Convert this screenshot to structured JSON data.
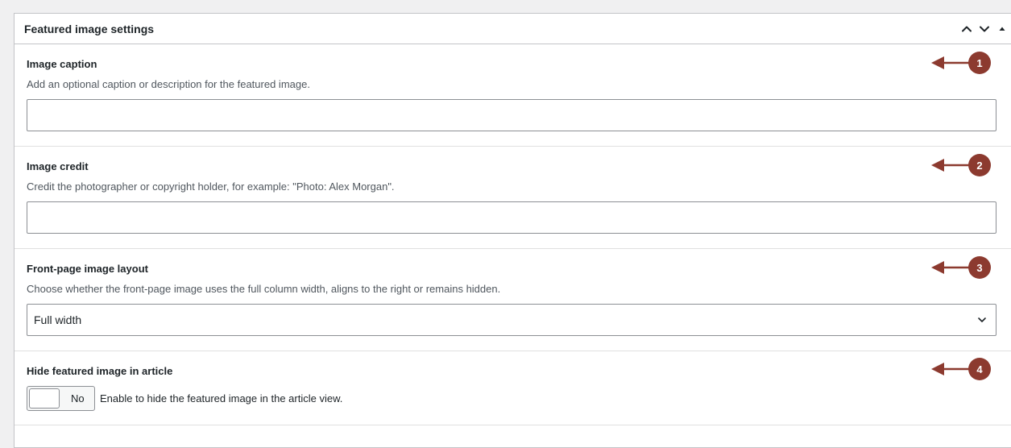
{
  "panel": {
    "title": "Featured image settings",
    "controls": [
      "move-up",
      "move-down",
      "toggle-panel"
    ]
  },
  "fields": {
    "caption": {
      "label": "Image caption",
      "description": "Add an optional caption or description for the featured image.",
      "value": ""
    },
    "credit": {
      "label": "Image credit",
      "description": "Credit the photographer or copyright holder, for example: \"Photo: Alex Morgan\".",
      "value": ""
    },
    "layout": {
      "label": "Front-page image layout",
      "description": "Choose whether the front-page image uses the full column width, aligns to the right or remains hidden.",
      "selected": "Full width"
    },
    "hide": {
      "label": "Hide featured image in article",
      "toggle_state": "No",
      "description": "Enable to hide the featured image in the article view."
    }
  },
  "annotations": [
    "1",
    "2",
    "3",
    "4"
  ],
  "colors": {
    "annotation": "#8c3a2f",
    "border": "#c3c4c7",
    "background": "#f0f0f1"
  }
}
